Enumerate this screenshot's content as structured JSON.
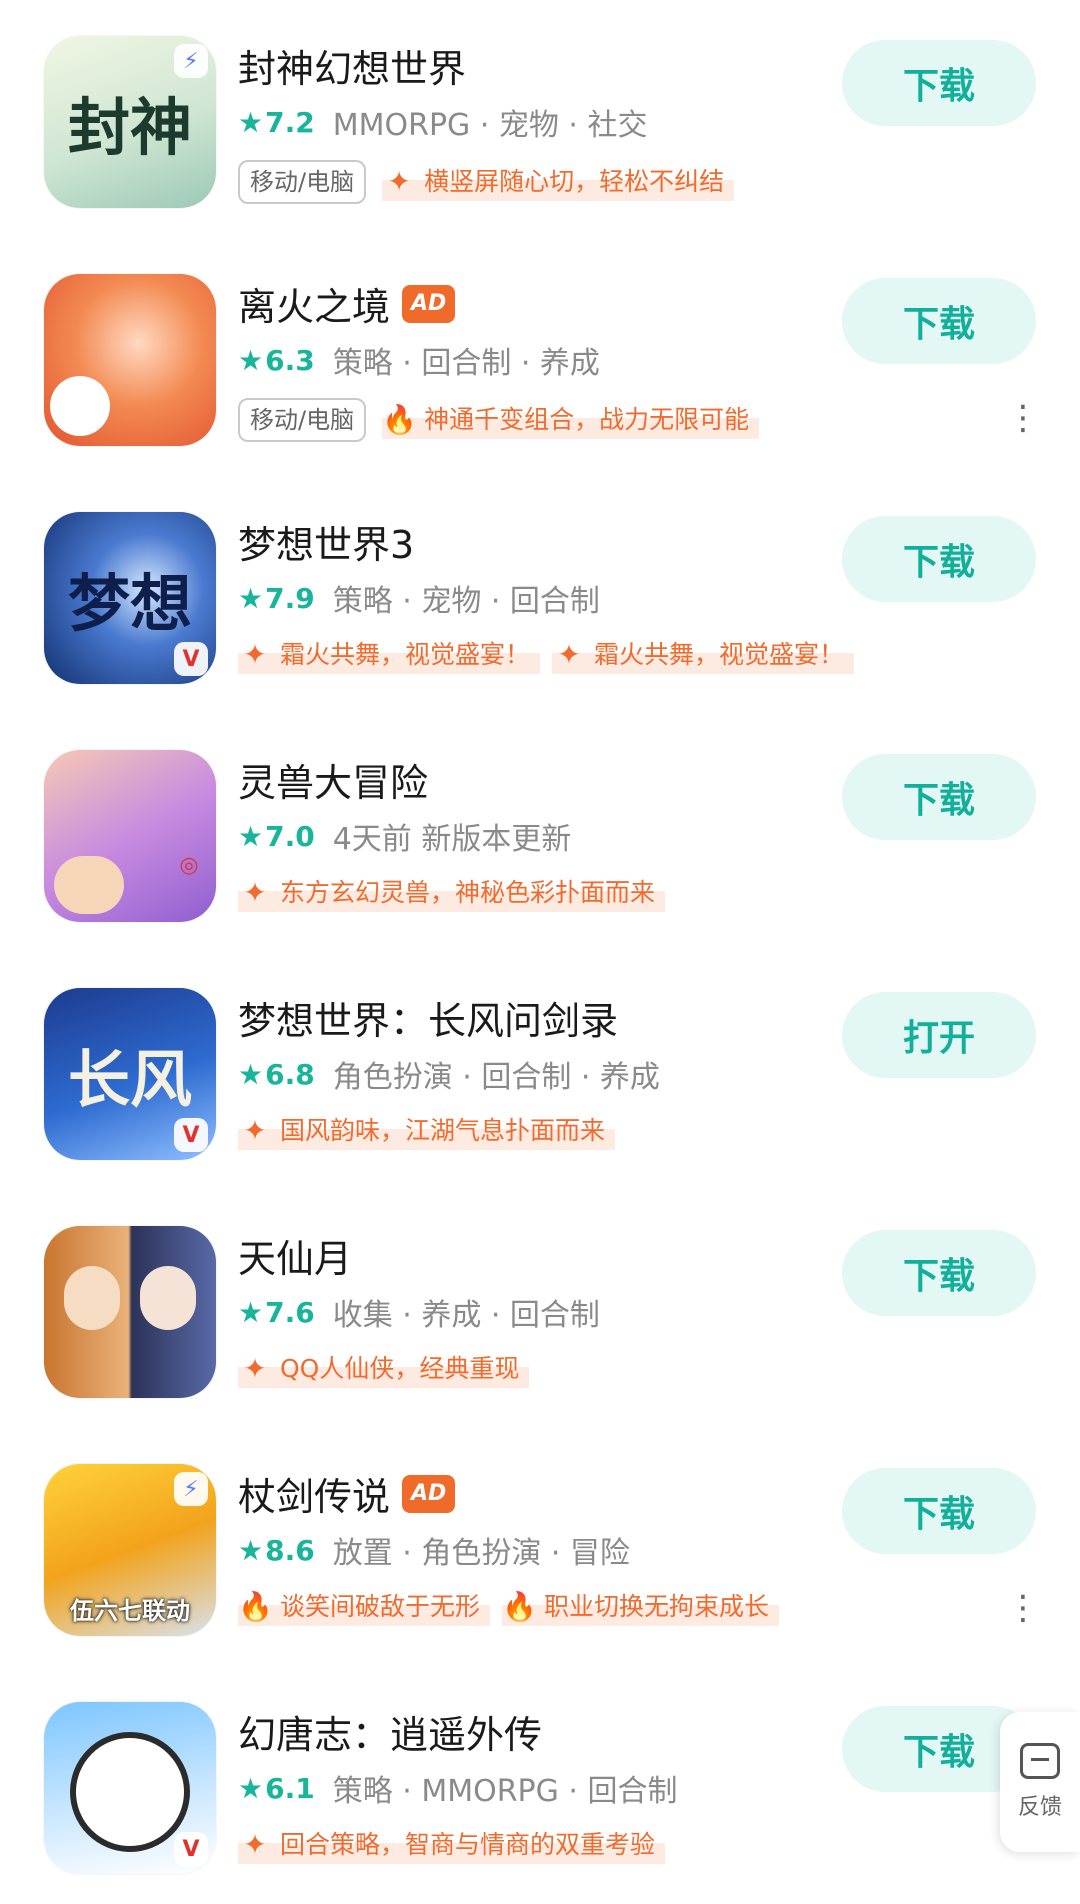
{
  "platform_label": "移动/电脑",
  "ad_label": "AD",
  "feedback_label": "反馈",
  "colors": {
    "accent": "#12b09a",
    "rating": "#18b59a",
    "highlight": "#f26b2e",
    "ad": "#f06a2a"
  },
  "apps": [
    {
      "title": "封神幻想世界",
      "icon_name": "fengshen-app-icon",
      "icon_text": "封神",
      "rating": "7.2",
      "meta": "MMORPG · 宠物 · 社交",
      "highlights": [
        {
          "icon": "sparkle-icon",
          "text": "横竖屏随心切，轻松不纠结"
        }
      ],
      "button": "下载"
    },
    {
      "title": "离火之境",
      "icon_name": "lihuo-app-icon",
      "icon_text": "",
      "rating": "6.3",
      "meta": "策略 · 回合制 · 养成",
      "highlights": [
        {
          "icon": "fire-icon",
          "text": "神通千变组合，战力无限可能"
        }
      ],
      "button": "下载"
    },
    {
      "title": "梦想世界3",
      "icon_name": "mengxiang-app-icon",
      "icon_text": "梦想",
      "rating": "7.9",
      "meta": "策略 · 宠物 · 回合制",
      "highlights": [
        {
          "icon": "sparkle-icon",
          "text": "霜火共舞，视觉盛宴！"
        },
        {
          "icon": "sparkle-icon",
          "text": "霜火共舞，视觉盛宴！"
        }
      ],
      "button": "下载"
    },
    {
      "title": "灵兽大冒险",
      "icon_name": "lingshou-app-icon",
      "icon_text": "",
      "rating": "7.0",
      "meta": "4天前 新版本更新",
      "highlights": [
        {
          "icon": "sparkle-icon",
          "text": "东方玄幻灵兽，神秘色彩扑面而来"
        }
      ],
      "button": "下载"
    },
    {
      "title": "梦想世界：长风问剑录",
      "icon_name": "changfeng-app-icon",
      "icon_text": "长风",
      "rating": "6.8",
      "meta": "角色扮演 · 回合制 · 养成",
      "highlights": [
        {
          "icon": "sparkle-icon",
          "text": "国风韵味，江湖气息扑面而来"
        }
      ],
      "button": "打开"
    },
    {
      "title": "天仙月",
      "icon_name": "tianxianyue-app-icon",
      "icon_text": "",
      "rating": "7.6",
      "meta": "收集 · 养成 · 回合制",
      "highlights": [
        {
          "icon": "sparkle-icon",
          "text": "QQ人仙侠，经典重现"
        }
      ],
      "button": "下载"
    },
    {
      "title": "杖剑传说",
      "icon_name": "zhangjian-app-icon",
      "icon_text": "伍六七联动",
      "rating": "8.6",
      "meta": "放置 · 角色扮演 · 冒险",
      "highlights": [
        {
          "icon": "fire-icon",
          "text": "谈笑间破敌于无形"
        },
        {
          "icon": "fire-icon",
          "text": "职业切换无拘束成长"
        }
      ],
      "button": "下载"
    },
    {
      "title": "幻唐志：逍遥外传",
      "icon_name": "huantang-app-icon",
      "icon_text": "",
      "rating": "6.1",
      "meta": "策略 · MMORPG · 回合制",
      "highlights": [
        {
          "icon": "sparkle-icon",
          "text": "回合策略，智商与情商的双重考验"
        }
      ],
      "button": "下载"
    }
  ]
}
